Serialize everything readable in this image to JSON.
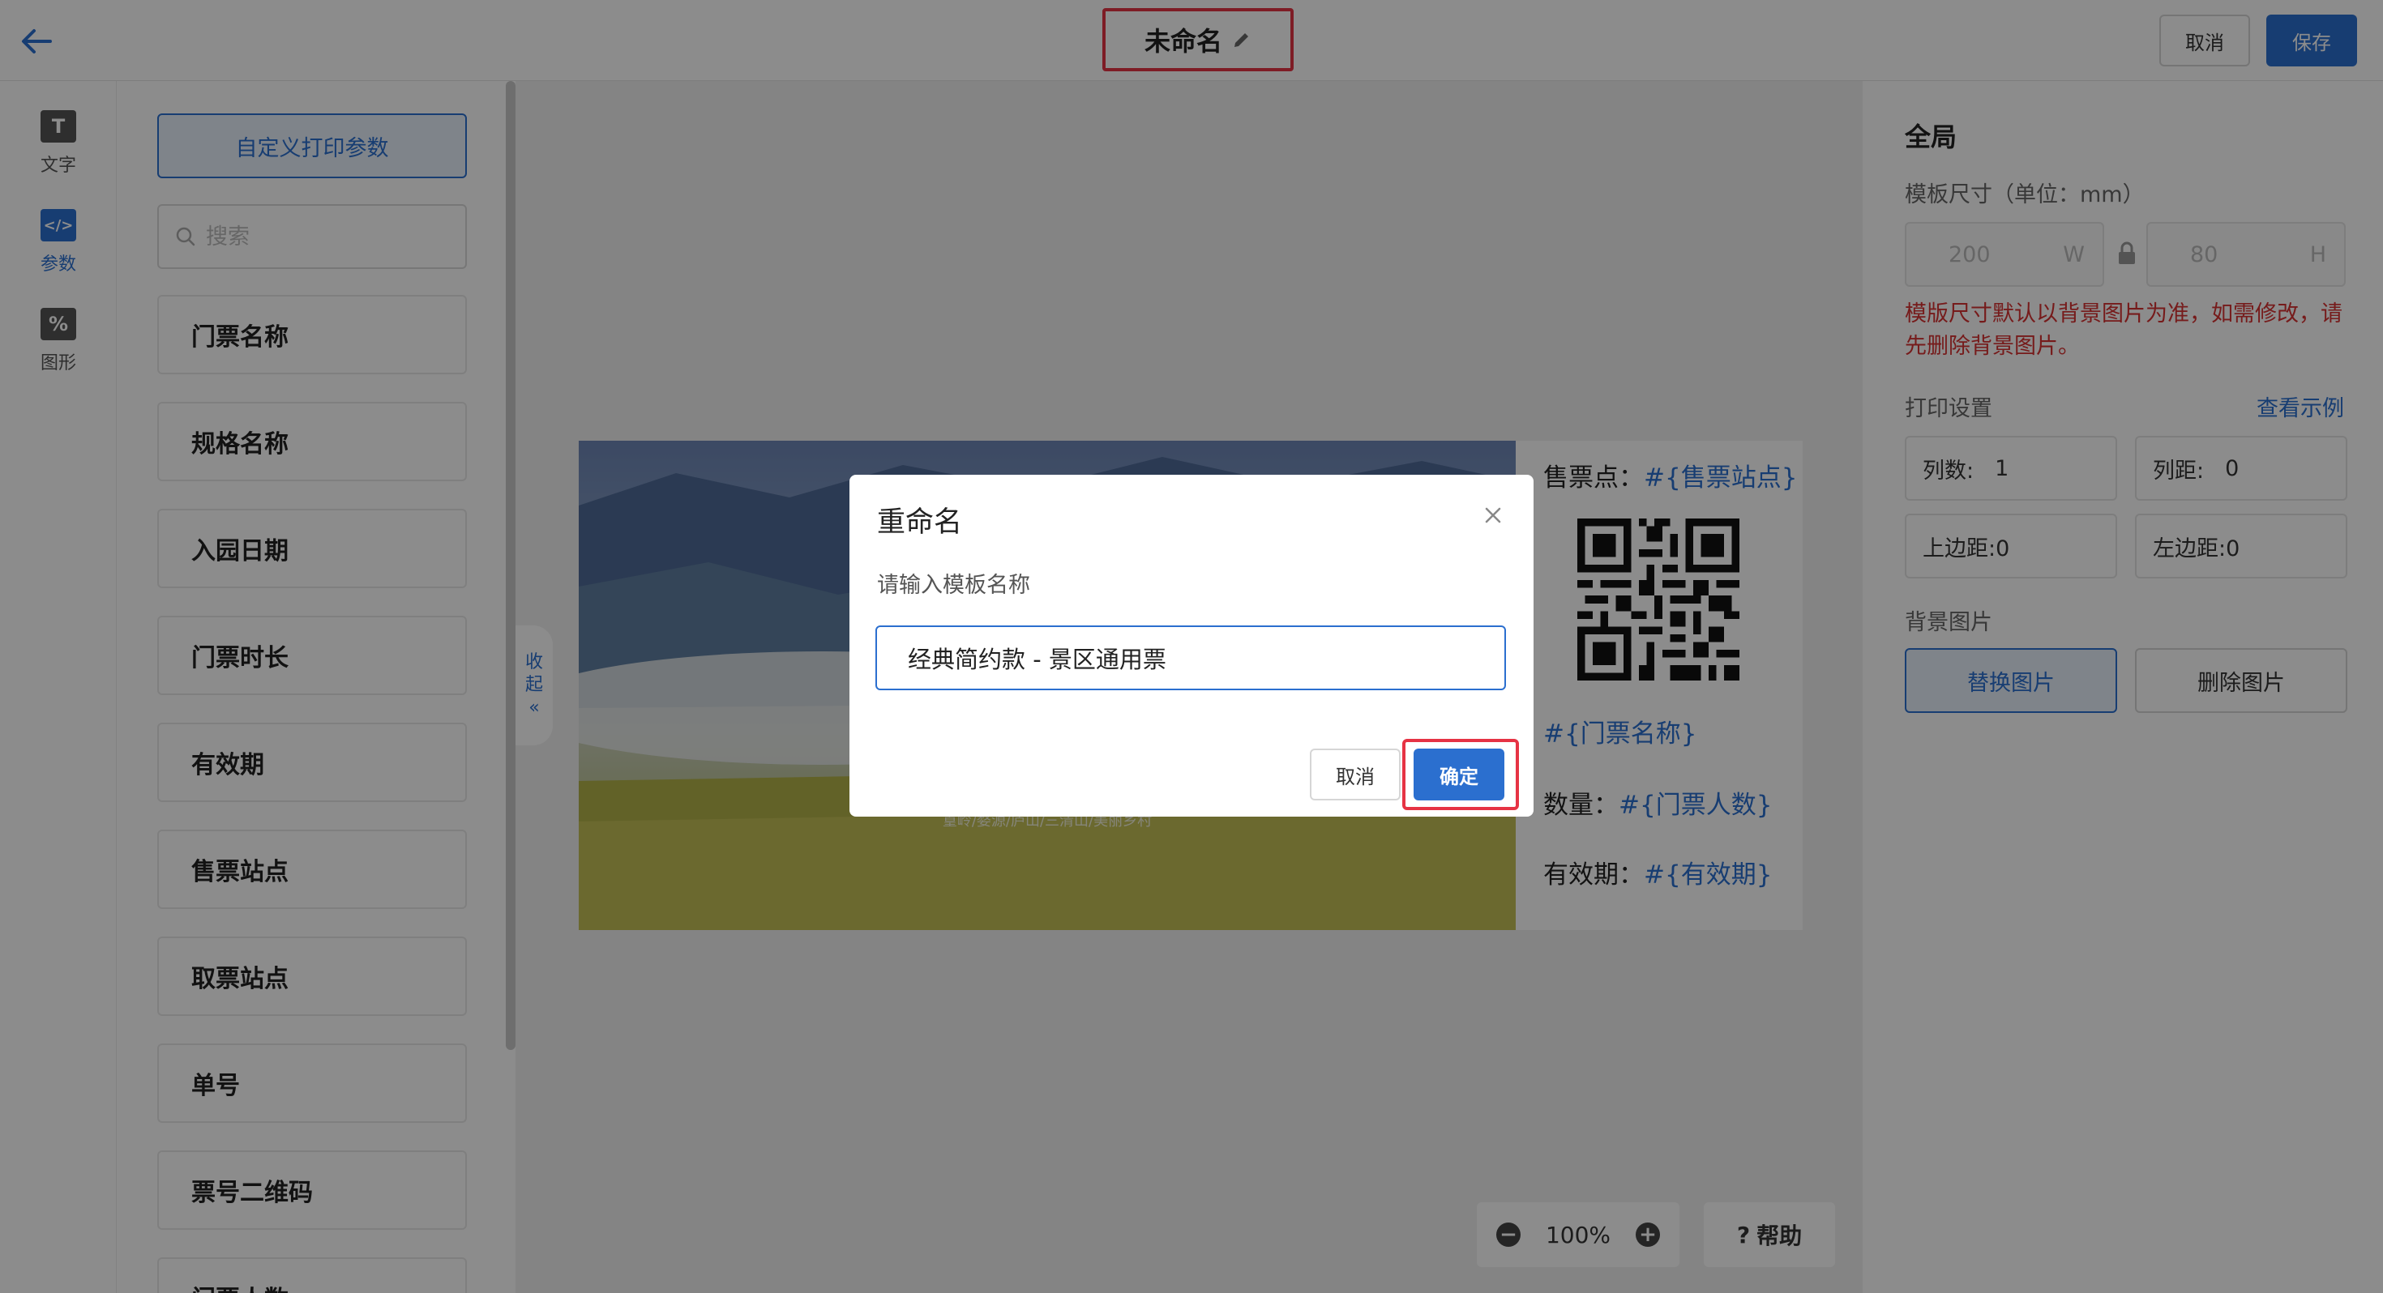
{
  "header": {
    "title": "未命名",
    "cancel_label": "取消",
    "save_label": "保存"
  },
  "rail": {
    "items": [
      {
        "label": "文字",
        "icon": "text-icon",
        "glyph": "T"
      },
      {
        "label": "参数",
        "icon": "code-icon",
        "glyph": "</>"
      },
      {
        "label": "图形",
        "icon": "shape-icon",
        "glyph": "%"
      }
    ]
  },
  "panel": {
    "custom_btn": "自定义打印参数",
    "search_placeholder": "搜索",
    "items": [
      "门票名称",
      "规格名称",
      "入园日期",
      "门票时长",
      "有效期",
      "售票站点",
      "取票站点",
      "单号",
      "票号二维码",
      "门票人数"
    ]
  },
  "canvas": {
    "collapse_label_1": "收",
    "collapse_label_2": "起",
    "collapse_arrow": "«",
    "ticket": {
      "sale_point_label": "售票点：",
      "sale_point_var": "#{售票站点}",
      "ticket_name_var": "#{门票名称}",
      "qty_label": "数量：",
      "qty_var": "#{门票人数}",
      "validity_label": "有效期：",
      "validity_var": "#{有效期}",
      "image_caption": "篁岭/婺源/庐山/三清山/美丽乡村"
    },
    "zoom_level": "100%",
    "zoom_out": "−",
    "zoom_in": "+",
    "help_label": "帮助",
    "help_glyph": "?"
  },
  "settings": {
    "title": "全局",
    "size_label": "模板尺寸（单位：mm）",
    "width_value": "200",
    "width_unit": "W",
    "height_value": "80",
    "height_unit": "H",
    "warning": "模版尺寸默认以背景图片为准，如需修改，请先删除背景图片。",
    "print_label": "打印设置",
    "example_link": "查看示例",
    "cols_label": "列数:",
    "cols_value": "1",
    "col_gap_label": "列距:",
    "col_gap_value": "0",
    "top_margin": "上边距:0",
    "left_margin": "左边距:0",
    "bg_label": "背景图片",
    "replace_btn": "替换图片",
    "delete_btn": "删除图片"
  },
  "modal": {
    "title": "重命名",
    "label": "请输入模板名称",
    "input_value": "经典简约款 - 景区通用票",
    "cancel_label": "取消",
    "ok_label": "确定"
  },
  "colors": {
    "primary": "#2b6fcf",
    "highlight": "#e63344",
    "warning": "#d83232"
  }
}
